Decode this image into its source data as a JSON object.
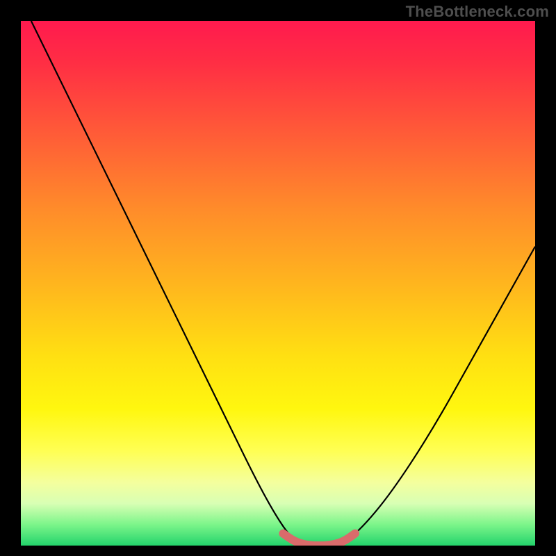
{
  "watermark": "TheBottleneck.com",
  "colors": {
    "page_bg": "#000000",
    "watermark_text": "#4e4e4e",
    "curve_stroke": "#000000",
    "marker_stroke": "#d96b6b",
    "gradient_top": "#ff1a4e",
    "gradient_bottom": "#23d36b"
  },
  "chart_data": {
    "type": "line",
    "title": "",
    "xlabel": "",
    "ylabel": "",
    "xlim": [
      0,
      100
    ],
    "ylim": [
      0,
      100
    ],
    "grid": false,
    "legend": false,
    "series": [
      {
        "name": "left-branch",
        "x": [
          2,
          10,
          18,
          26,
          34,
          40,
          46,
          50,
          53,
          56
        ],
        "y": [
          100,
          84,
          68,
          52,
          36,
          24,
          12,
          5,
          1,
          0
        ]
      },
      {
        "name": "right-branch",
        "x": [
          62,
          66,
          72,
          80,
          88,
          96,
          100
        ],
        "y": [
          0,
          3,
          10,
          22,
          36,
          50,
          57
        ]
      },
      {
        "name": "optimal-marker",
        "x": [
          51,
          53,
          55,
          57,
          59,
          61,
          63,
          65
        ],
        "y": [
          2.3,
          0.9,
          0.2,
          0,
          0,
          0.2,
          0.9,
          2.3
        ]
      }
    ],
    "annotations": []
  }
}
